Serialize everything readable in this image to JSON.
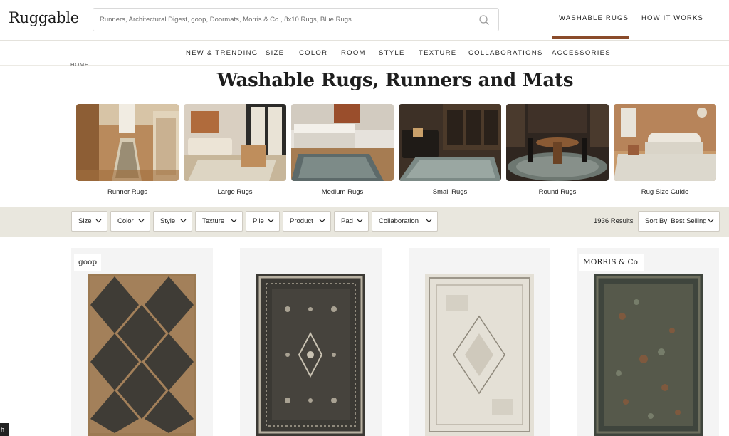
{
  "header": {
    "logo": "Ruggable",
    "search_placeholder": "Runners, Architectural Digest, goop, Doormats, Morris & Co., 8x10 Rugs, Blue Rugs...",
    "nav": [
      {
        "label": "WASHABLE RUGS",
        "active": true
      },
      {
        "label": "HOW IT WORKS"
      }
    ]
  },
  "category_nav": [
    "NEW & TRENDING",
    "SIZE",
    "COLOR",
    "ROOM",
    "STYLE",
    "TEXTURE",
    "COLLABORATIONS",
    "ACCESSORIES"
  ],
  "breadcrumb": "HOME",
  "page_title": "Washable Rugs, Runners and Mats",
  "category_tiles": [
    {
      "label": "Runner Rugs"
    },
    {
      "label": "Large Rugs"
    },
    {
      "label": "Medium Rugs"
    },
    {
      "label": "Small Rugs"
    },
    {
      "label": "Round Rugs"
    },
    {
      "label": "Rug Size Guide"
    }
  ],
  "filters": [
    "Size",
    "Color",
    "Style",
    "Texture",
    "Pile",
    "Product",
    "Pad",
    "Collaboration"
  ],
  "results_count": "1936 Results",
  "sort": "Sort By: Best Selling",
  "products": [
    {
      "brand": "goop"
    },
    {
      "brand": ""
    },
    {
      "brand": ""
    },
    {
      "brand": "MORRIS & Co."
    }
  ],
  "corner_chip": "h",
  "colors": {
    "accent": "#8a4b2a",
    "filter_bar": "#e9e7de"
  }
}
